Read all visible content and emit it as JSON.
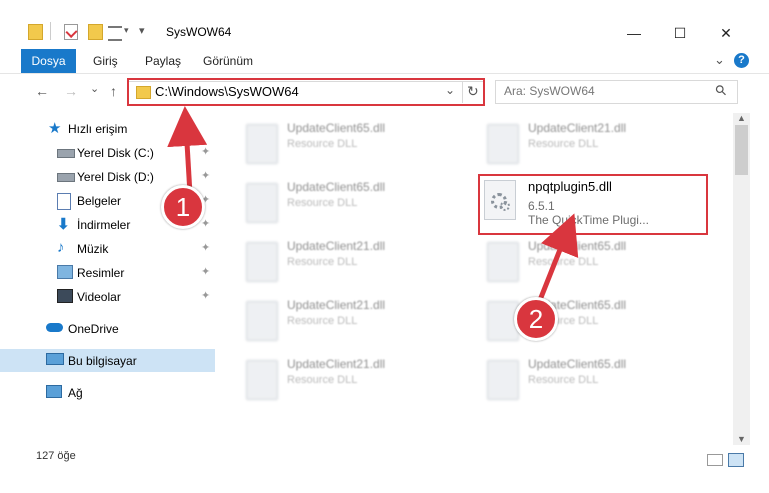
{
  "window": {
    "title": "SysWOW64",
    "minimize_glyph": "—",
    "maximize_glyph": "☐",
    "close_glyph": "✕"
  },
  "ribbon": {
    "tabs": [
      "Dosya",
      "Giriş",
      "Paylaş",
      "Görünüm"
    ],
    "help_glyph": "?",
    "expand_glyph": "⌄"
  },
  "nav": {
    "back_glyph": "←",
    "forward_glyph": "→",
    "recent_glyph": "⌄",
    "up_glyph": "↑"
  },
  "address": {
    "path": "C:\\Windows\\SysWOW64",
    "dropdown_glyph": "⌄",
    "refresh_glyph": "↻"
  },
  "search": {
    "placeholder": "Ara: SysWOW64",
    "icon_glyph": "⚲"
  },
  "sidebar": {
    "items": [
      {
        "label": "Hızlı erişim",
        "icon": "star-icon",
        "pinned": false
      },
      {
        "label": "Yerel Disk (C:)",
        "icon": "drive-icon",
        "pinned": true
      },
      {
        "label": "Yerel Disk (D:)",
        "icon": "drive-icon",
        "pinned": true
      },
      {
        "label": "Belgeler",
        "icon": "documents-icon",
        "pinned": true
      },
      {
        "label": "İndirmeler",
        "icon": "download-icon",
        "pinned": true
      },
      {
        "label": "Müzik",
        "icon": "music-icon",
        "pinned": true
      },
      {
        "label": "Resimler",
        "icon": "pictures-icon",
        "pinned": true
      },
      {
        "label": "Videolar",
        "icon": "videos-icon",
        "pinned": true
      },
      {
        "label": "OneDrive",
        "icon": "cloud-icon",
        "pinned": false
      },
      {
        "label": "Bu bilgisayar",
        "icon": "computer-icon",
        "pinned": false,
        "selected": true
      },
      {
        "label": "Ağ",
        "icon": "network-icon",
        "pinned": false
      }
    ],
    "pin_glyph": "📌"
  },
  "files": {
    "left_column": [
      {
        "name": "UpdateClient65.dll",
        "desc": "Resource DLL"
      },
      {
        "name": "UpdateClient65.dll",
        "desc": "Resource DLL"
      },
      {
        "name": "UpdateClient21.dll",
        "desc": "Resource DLL"
      },
      {
        "name": "UpdateClient21.dll",
        "desc": "Resource DLL"
      },
      {
        "name": "UpdateClient21.dll",
        "desc": "Resource DLL"
      }
    ],
    "right_column": [
      {
        "name": "UpdateClient21.dll",
        "desc": "Resource DLL"
      },
      {
        "name": "UpdateClient65.dll",
        "desc": "Resource DLL"
      },
      {
        "name": "UpdateClient65.dll",
        "desc": "Resource DLL"
      },
      {
        "name": "UpdateClient65.dll",
        "desc": "Resource DLL"
      }
    ],
    "focused": {
      "name": "npqtplugin5.dll",
      "version": "6.5.1",
      "description": "The QuickTime Plugi..."
    }
  },
  "status": {
    "count": "127 öğe"
  },
  "callouts": {
    "one": "1",
    "two": "2",
    "color": "#d9363e"
  },
  "colors": {
    "accent": "#1979ca",
    "selection": "#cde3f5",
    "highlight": "#d9363e"
  }
}
